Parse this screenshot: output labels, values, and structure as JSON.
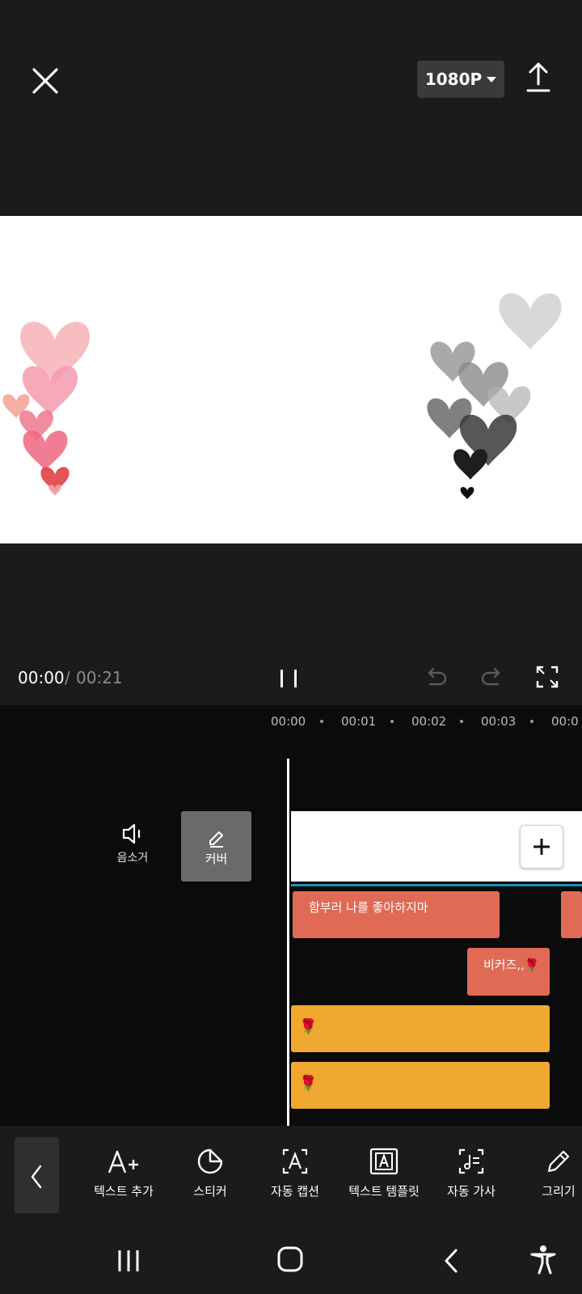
{
  "header": {
    "resolution": "1080P",
    "close_icon": "close-icon",
    "export_icon": "upload-icon"
  },
  "preview": {
    "background": "#ffffff",
    "left_hearts_colors": [
      "#f7b6b9",
      "#f08aa0",
      "#e24a56"
    ],
    "right_hearts_colors": [
      "#d9d9d9",
      "#8a8a8a",
      "#1a1a1a"
    ]
  },
  "playback": {
    "current_time": "00:00",
    "separator": " / ",
    "total_time": "00:21"
  },
  "timeline": {
    "ruler": [
      "00:00",
      "00:01",
      "00:02",
      "00:03",
      "00:0"
    ],
    "mute_label": "음소거",
    "cover_label": "커버",
    "text_clips": [
      "함부러 나를 좋아하지마",
      "비커즈,,🌹"
    ],
    "sticker_clips": [
      "🌹",
      "🌹"
    ],
    "accent_color": "#1a8fb0",
    "text_clip_color": "#e06a55",
    "sticker_clip_color": "#f0a830"
  },
  "toolbar": {
    "items": [
      {
        "label": "텍스트 추가",
        "icon": "text-add-icon"
      },
      {
        "label": "스티커",
        "icon": "sticker-icon"
      },
      {
        "label": "자동 캡션",
        "icon": "auto-caption-icon"
      },
      {
        "label": "텍스트 템플릿",
        "icon": "text-template-icon"
      },
      {
        "label": "자동 가사",
        "icon": "auto-lyrics-icon"
      },
      {
        "label": "그리기",
        "icon": "pen-icon"
      }
    ]
  }
}
